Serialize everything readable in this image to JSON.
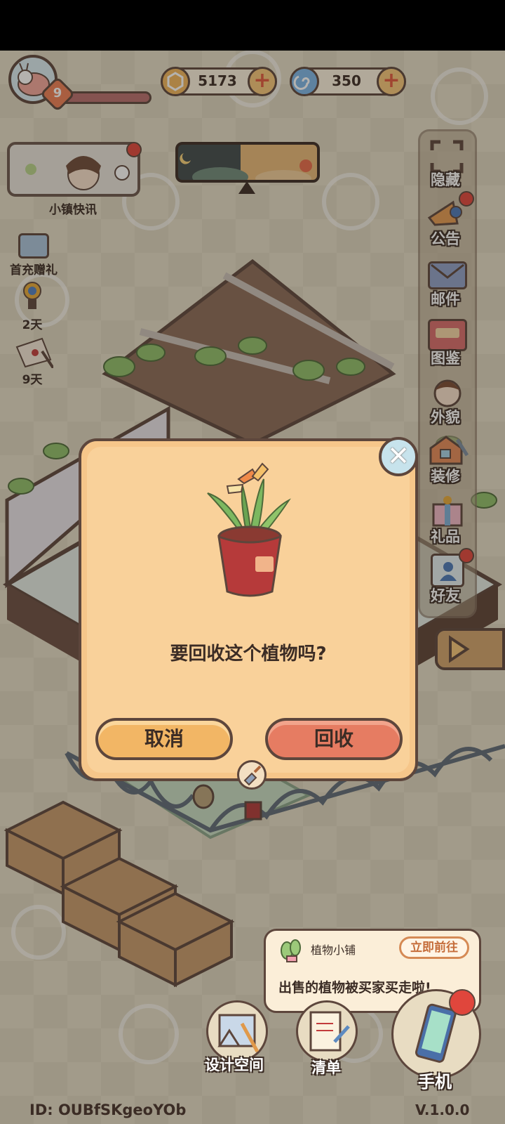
{
  "player": {
    "level": "9",
    "avatar_icon": "snail-icon"
  },
  "currencies": {
    "coins": "5173",
    "gems": "350",
    "coin_icon": "coin-icon",
    "gem_icon": "swirl-gem-icon"
  },
  "news": {
    "label": "小镇快讯"
  },
  "left_menu": {
    "first_recharge": "首充赠礼",
    "trophy_days": "2天",
    "letter_days": "9天"
  },
  "right_menu": {
    "hide": "隐藏",
    "announcement": "公告",
    "mail": "邮件",
    "catalog": "图鉴",
    "appearance": "外貌",
    "decorate": "装修",
    "gift": "礼品",
    "friends": "好友"
  },
  "dialog": {
    "question": "要回收这个植物吗?",
    "cancel": "取消",
    "recycle": "回收",
    "close_glyph": "✕"
  },
  "notice": {
    "shop_name": "植物小铺",
    "go_now": "立即前往",
    "message": "出售的植物被买家买走啦!"
  },
  "bottom_bar": {
    "design": "设计空间",
    "list": "清单",
    "phone": "手机"
  },
  "footer": {
    "id": "ID: OUBfSKgeoYOb",
    "version": "V.1.0.0"
  },
  "colors": {
    "outline": "#5d463c",
    "dialog_bg": "#f6c68a",
    "cancel_btn": "#f2b665",
    "recycle_btn": "#e67c62",
    "badge_red": "#e0463c"
  }
}
